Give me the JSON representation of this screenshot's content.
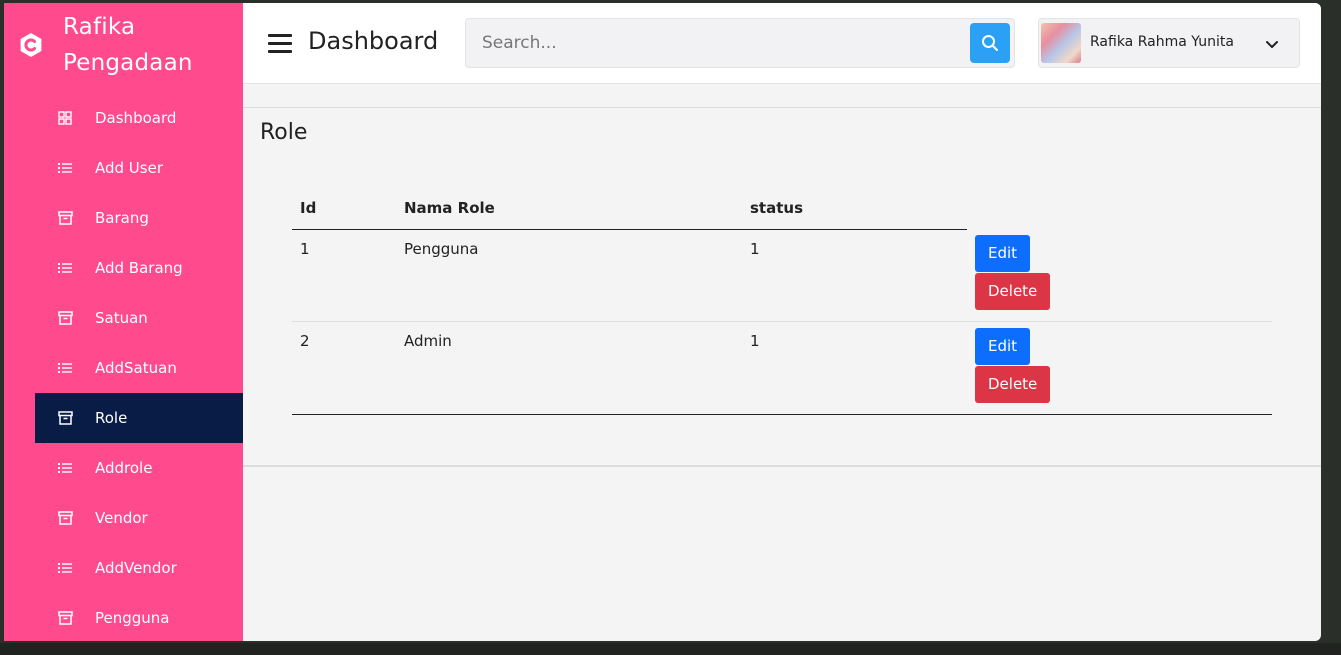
{
  "app": {
    "brand_line1": "Rafika",
    "brand_line2": "Pengadaan"
  },
  "sidebar": {
    "items": [
      {
        "label": "Dashboard",
        "icon": "grid-icon"
      },
      {
        "label": "Add User",
        "icon": "list-icon"
      },
      {
        "label": "Barang",
        "icon": "archive-icon"
      },
      {
        "label": "Add Barang",
        "icon": "list-icon"
      },
      {
        "label": "Satuan",
        "icon": "archive-icon"
      },
      {
        "label": "AddSatuan",
        "icon": "list-icon"
      },
      {
        "label": "Role",
        "icon": "archive-icon",
        "active": true
      },
      {
        "label": "Addrole",
        "icon": "list-icon"
      },
      {
        "label": "Vendor",
        "icon": "archive-icon"
      },
      {
        "label": "AddVendor",
        "icon": "list-icon"
      },
      {
        "label": "Pengguna",
        "icon": "archive-icon"
      }
    ]
  },
  "header": {
    "title": "Dashboard",
    "search_placeholder": "Search...",
    "user_name": "Rafika Rahma Yunita"
  },
  "page": {
    "title": "Role",
    "table": {
      "headers": [
        "Id",
        "Nama Role",
        "status",
        ""
      ],
      "rows": [
        {
          "id": "1",
          "nama_role": "Pengguna",
          "status": "1",
          "edit": "Edit",
          "delete": "Delete"
        },
        {
          "id": "2",
          "nama_role": "Admin",
          "status": "1",
          "edit": "Edit",
          "delete": "Delete"
        }
      ]
    }
  },
  "colors": {
    "sidebar": "#ff4a8d",
    "sidebar_active": "#081c45",
    "edit": "#0d6efd",
    "delete": "#dc3545",
    "search_button": "#2aa1f5"
  }
}
